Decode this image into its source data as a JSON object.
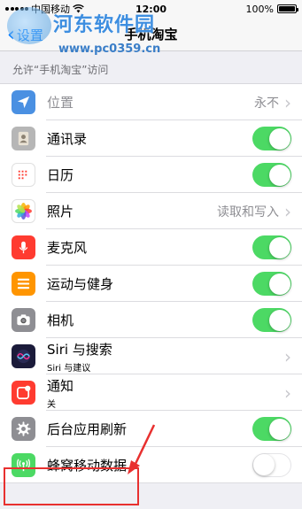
{
  "status_bar": {
    "carrier": "中国移动",
    "time": "12:00",
    "battery": "100%",
    "battery_level": 1.0
  },
  "nav": {
    "back_label": "设置",
    "title": "手机淘宝"
  },
  "watermark": {
    "title": "河东软件园",
    "url": "www.pc0359.cn"
  },
  "section": {
    "header": "允许“手机淘宝”访问"
  },
  "rows": [
    {
      "label": "位置",
      "value": "永不",
      "icon": "location-arrow-icon",
      "color": "#4a90e2",
      "type": "value",
      "dim": true
    },
    {
      "label": "通讯录",
      "icon": "contacts-icon",
      "color": "#b6b6b6",
      "type": "toggle",
      "on": true
    },
    {
      "label": "日历",
      "icon": "calendar-icon",
      "color": "#ffffff",
      "type": "toggle",
      "on": true
    },
    {
      "label": "照片",
      "value": "读取和写入",
      "icon": "photos-icon",
      "color": "#ffffff",
      "type": "value"
    },
    {
      "label": "麦克风",
      "icon": "microphone-icon",
      "color": "#ff3b30",
      "type": "toggle",
      "on": true
    },
    {
      "label": "运动与健身",
      "icon": "motion-fitness-icon",
      "color": "#ff9500",
      "type": "toggle",
      "on": true
    },
    {
      "label": "相机",
      "icon": "camera-icon",
      "color": "#8e8e93",
      "type": "toggle",
      "on": true
    },
    {
      "label": "Siri 与搜索",
      "sublabel": "Siri 与建议",
      "icon": "siri-icon",
      "color": "#1b1b3a",
      "type": "chevron"
    },
    {
      "label": "通知",
      "sublabel": "关",
      "icon": "notifications-icon",
      "color": "#ff3b30",
      "type": "chevron"
    },
    {
      "label": "后台应用刷新",
      "icon": "gear-icon",
      "color": "#8e8e93",
      "type": "toggle",
      "on": true
    },
    {
      "label": "蜂窝移动数据",
      "icon": "cellular-antenna-icon",
      "color": "#4cd964",
      "type": "toggle",
      "on": false
    }
  ]
}
